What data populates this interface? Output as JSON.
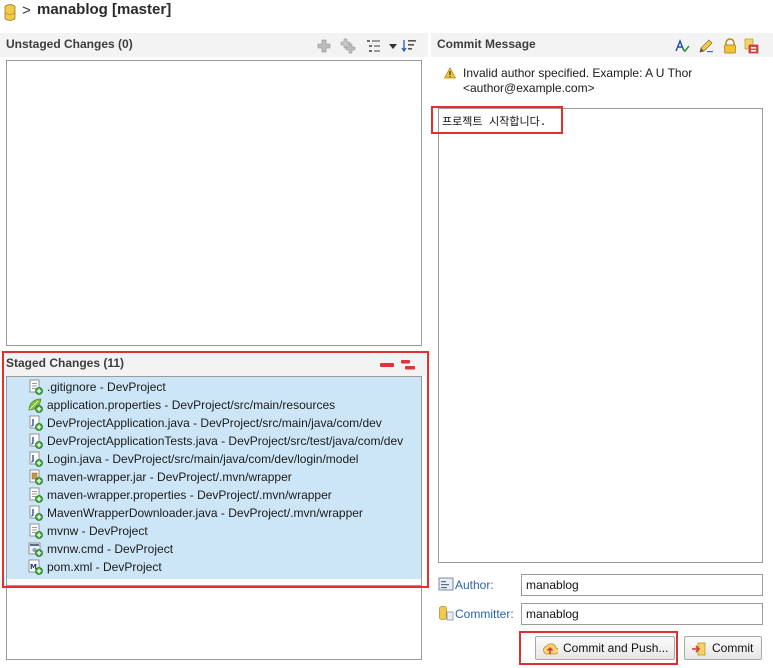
{
  "header": {
    "separator": ">",
    "title": "manablog [master]"
  },
  "unstaged": {
    "title": "Unstaged Changes (0)",
    "toolbar_icons": [
      "add-icon",
      "add-all-icon",
      "presentation-icon",
      "dropdown-arrow-icon",
      "sort-icon"
    ]
  },
  "staged": {
    "title": "Staged Changes (11)",
    "toolbar_icons": [
      "remove-icon",
      "remove-all-icon"
    ],
    "files": [
      {
        "name": ".gitignore - DevProject",
        "icon": "text-file-icon"
      },
      {
        "name": "application.properties - DevProject/src/main/resources",
        "icon": "spring-leaf-icon"
      },
      {
        "name": "DevProjectApplication.java - DevProject/src/main/java/com/dev",
        "icon": "java-file-icon"
      },
      {
        "name": "DevProjectApplicationTests.java - DevProject/src/test/java/com/dev",
        "icon": "java-file-icon"
      },
      {
        "name": "Login.java - DevProject/src/main/java/com/dev/login/model",
        "icon": "java-file-icon"
      },
      {
        "name": "maven-wrapper.jar - DevProject/.mvn/wrapper",
        "icon": "jar-file-icon"
      },
      {
        "name": "maven-wrapper.properties - DevProject/.mvn/wrapper",
        "icon": "text-file-icon"
      },
      {
        "name": "MavenWrapperDownloader.java - DevProject/.mvn/wrapper",
        "icon": "java-file-icon"
      },
      {
        "name": "mvnw - DevProject",
        "icon": "text-file-icon"
      },
      {
        "name": "mvnw.cmd - DevProject",
        "icon": "cmd-file-icon"
      },
      {
        "name": "pom.xml - DevProject",
        "icon": "maven-pom-icon"
      }
    ]
  },
  "commit": {
    "title": "Commit Message",
    "toolbar_icons": [
      "spell-check-icon",
      "edit-icon",
      "sign-off-icon",
      "change-id-icon"
    ],
    "warning": "Invalid author specified. Example: A U Thor <author@example.com>",
    "message": "프로젝트 시작합니다.",
    "author_label": "Author:",
    "author_value": "manablog",
    "committer_label": "Committer:",
    "committer_value": "manablog",
    "commit_push_label": "Commit and Push...",
    "commit_label": "Commit"
  },
  "colors": {
    "highlight": "#e03030",
    "selection": "#cde6f7",
    "link_label": "#2a65b0"
  }
}
